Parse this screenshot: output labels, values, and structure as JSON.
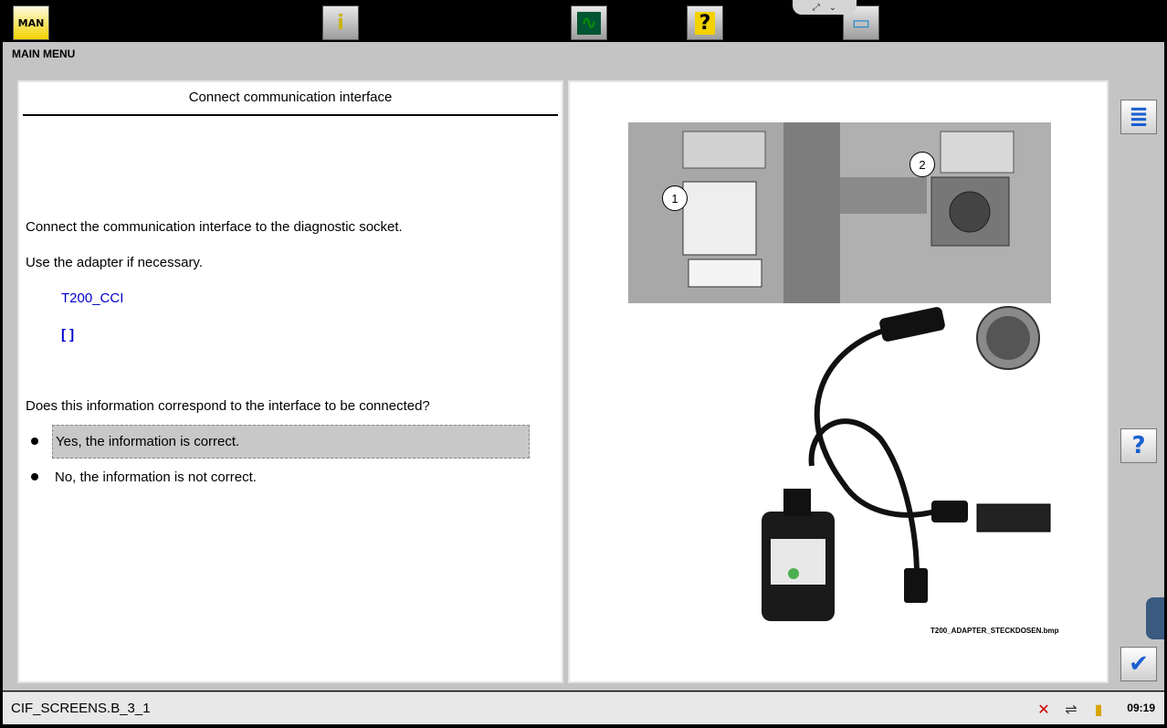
{
  "toolbar": {
    "buttons": [
      {
        "name": "man-logo-button",
        "icon": "man-logo-icon",
        "glyph": "MAN",
        "active": true
      },
      {
        "name": "info-button",
        "icon": "info-person-icon",
        "glyph": "i"
      },
      {
        "name": "measure-button",
        "icon": "oscilloscope-icon",
        "glyph": "∿"
      },
      {
        "name": "help-button",
        "icon": "help-bubble-icon",
        "glyph": "?"
      },
      {
        "name": "computer-button",
        "icon": "computer-icon",
        "glyph": "▭"
      }
    ],
    "notch": {
      "expand": "⤢",
      "collapse": "⌄"
    }
  },
  "header": {
    "main_menu": "MAIN MENU"
  },
  "left_panel": {
    "title": "Connect communication interface",
    "instruction1": "Connect the communication interface to the diagnostic socket.",
    "instruction2": "Use the adapter if necessary.",
    "interface_name": "T200_CCI",
    "interface_extra": "[ ]",
    "question": "Does this information correspond to the interface to be connected?",
    "options": [
      {
        "label": "Yes, the information is correct.",
        "selected": true
      },
      {
        "label": "No, the information is not correct.",
        "selected": false
      }
    ]
  },
  "right_panel": {
    "callouts": [
      "1",
      "2"
    ],
    "image_caption": "T200_ADAPTER_STECKDOSEN.bmp"
  },
  "side_buttons": {
    "list": "≣",
    "help": "?",
    "confirm": "✔"
  },
  "status": {
    "screen_code": "CIF_SCREENS.B_3_1",
    "time": "09:19"
  },
  "colors": {
    "accent_blue": "#0000cc",
    "toolbar_active": "#f3d200"
  }
}
